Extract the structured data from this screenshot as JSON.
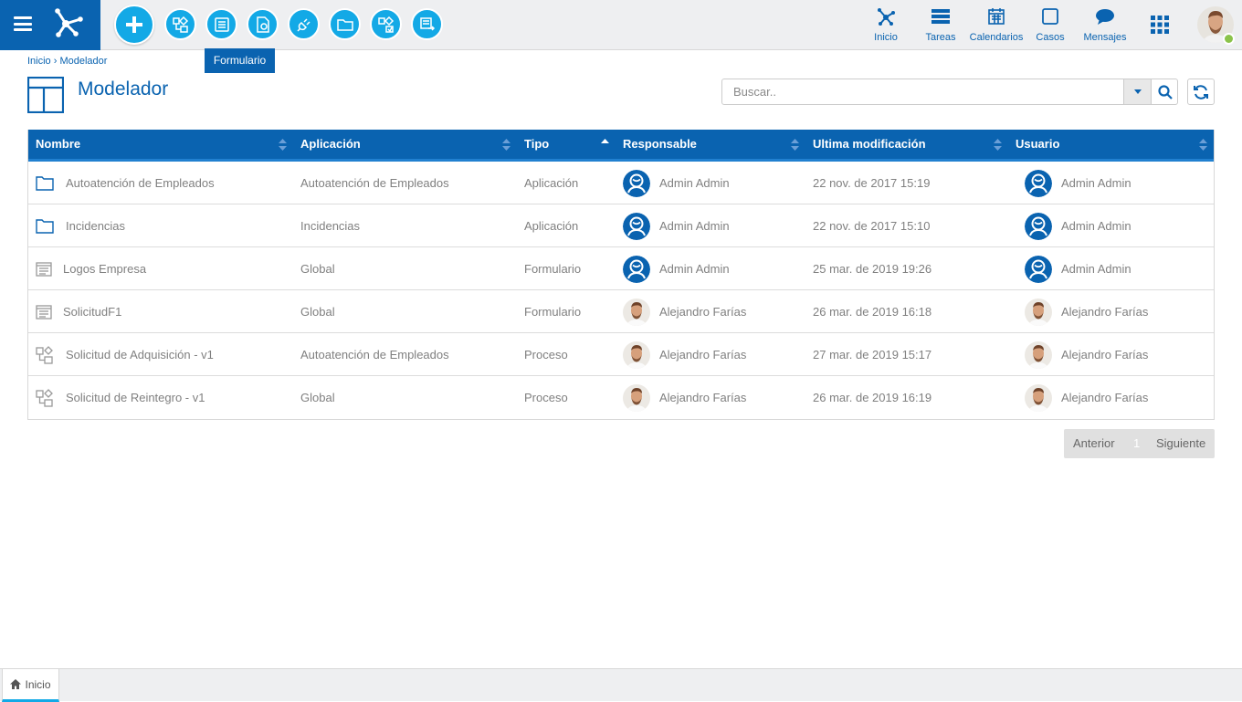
{
  "toolbar": {
    "tooltip": "Formulario",
    "nav": [
      {
        "label": "Inicio",
        "icon": "network-icon"
      },
      {
        "label": "Tareas",
        "icon": "tasks-icon"
      },
      {
        "label": "Calendarios",
        "icon": "calendar-icon"
      },
      {
        "label": "Casos",
        "icon": "cases-icon"
      },
      {
        "label": "Mensajes",
        "icon": "chat-icon"
      }
    ]
  },
  "breadcrumb": "Inicio › Modelador",
  "page": {
    "title": "Modelador"
  },
  "search": {
    "placeholder": "Buscar.."
  },
  "grid": {
    "headers": [
      "Nombre",
      "Aplicación",
      "Tipo",
      "Responsable",
      "Ultima modificación",
      "Usuario"
    ],
    "rows": [
      {
        "icon": "folder",
        "name": "Autoatención de Empleados",
        "app": "Autoatención de Empleados",
        "type": "Aplicación",
        "resp": "Admin Admin",
        "resp_avatar": "admin",
        "date": "22 nov. de 2017 15:19",
        "user": "Admin Admin",
        "user_avatar": "admin"
      },
      {
        "icon": "folder",
        "name": "Incidencias",
        "app": "Incidencias",
        "type": "Aplicación",
        "resp": "Admin Admin",
        "resp_avatar": "admin",
        "date": "22 nov. de 2017 15:10",
        "user": "Admin Admin",
        "user_avatar": "admin"
      },
      {
        "icon": "form",
        "name": "Logos Empresa",
        "app": "Global",
        "type": "Formulario",
        "resp": "Admin Admin",
        "resp_avatar": "admin",
        "date": "25 mar. de 2019 19:26",
        "user": "Admin Admin",
        "user_avatar": "admin"
      },
      {
        "icon": "form",
        "name": "SolicitudF1",
        "app": "Global",
        "type": "Formulario",
        "resp": "Alejandro Farías",
        "resp_avatar": "photo",
        "date": "26 mar. de 2019 16:18",
        "user": "Alejandro Farías",
        "user_avatar": "photo"
      },
      {
        "icon": "process",
        "name": "Solicitud de Adquisición - v1",
        "app": "Autoatención de Empleados",
        "type": "Proceso",
        "resp": "Alejandro Farías",
        "resp_avatar": "photo",
        "date": "27 mar. de 2019 15:17",
        "user": "Alejandro Farías",
        "user_avatar": "photo"
      },
      {
        "icon": "process",
        "name": "Solicitud de Reintegro - v1",
        "app": "Global",
        "type": "Proceso",
        "resp": "Alejandro Farías",
        "resp_avatar": "photo",
        "date": "26 mar. de 2019 16:19",
        "user": "Alejandro Farías",
        "user_avatar": "photo"
      }
    ]
  },
  "pager": {
    "prev": "Anterior",
    "page": "1",
    "next": "Siguiente"
  },
  "footer": {
    "tab": "Inicio"
  },
  "colors": {
    "brand": "#0a63b0",
    "accent": "#13a9e6",
    "online": "#8bc34a"
  }
}
